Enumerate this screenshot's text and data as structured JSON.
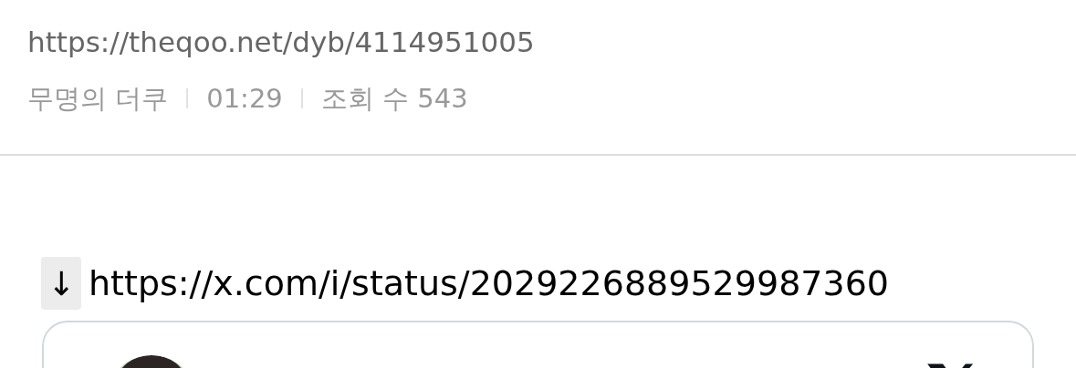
{
  "post": {
    "url": "https://theqoo.net/dyb/4114951005",
    "meta": [
      "무명의 더쿠",
      "01:29",
      "조회 수 543"
    ]
  },
  "body": {
    "link_marker": "↓",
    "link": "https://x.com/i/status/2029226889529987360"
  }
}
